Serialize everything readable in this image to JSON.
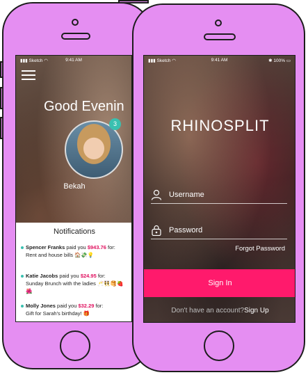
{
  "back_phone": {
    "status_bar": {
      "carrier": "Sketch",
      "time": "9:41 AM"
    },
    "greeting": "Good Evenin",
    "avatar_badge": "3",
    "user_name": "Bekah",
    "notifications": {
      "title": "Notifications",
      "items": [
        {
          "sender": "Spencer Franks",
          "verb": " paid you ",
          "amount": "$943.76",
          "suffix": " for:",
          "memo": "Rent and house bills 🏠💸💡"
        },
        {
          "sender": "Katie Jacobs",
          "verb": " paid you ",
          "amount": "$24.95",
          "suffix": " for:",
          "memo": "Sunday Brunch with the ladies 🥂👯🥞🍓🌺"
        },
        {
          "sender": "Molly Jones",
          "verb": " paid you ",
          "amount": "$32.29",
          "suffix": " for:",
          "memo": "Gift for Sarah's birthday! 🎁"
        }
      ]
    }
  },
  "front_phone": {
    "status_bar": {
      "carrier": "Sketch",
      "time": "9:41 AM",
      "battery": "100%"
    },
    "logo": "RHINOSPLIT",
    "username_placeholder": "Username",
    "password_placeholder": "Password",
    "forgot_password": "Forgot Password",
    "sign_in": "Sign In",
    "no_account": "Don't have an account?",
    "sign_up": "Sign Up"
  },
  "colors": {
    "frame": "#e58ef2",
    "accent": "#ff1a6c",
    "teal": "#39c0b0"
  }
}
